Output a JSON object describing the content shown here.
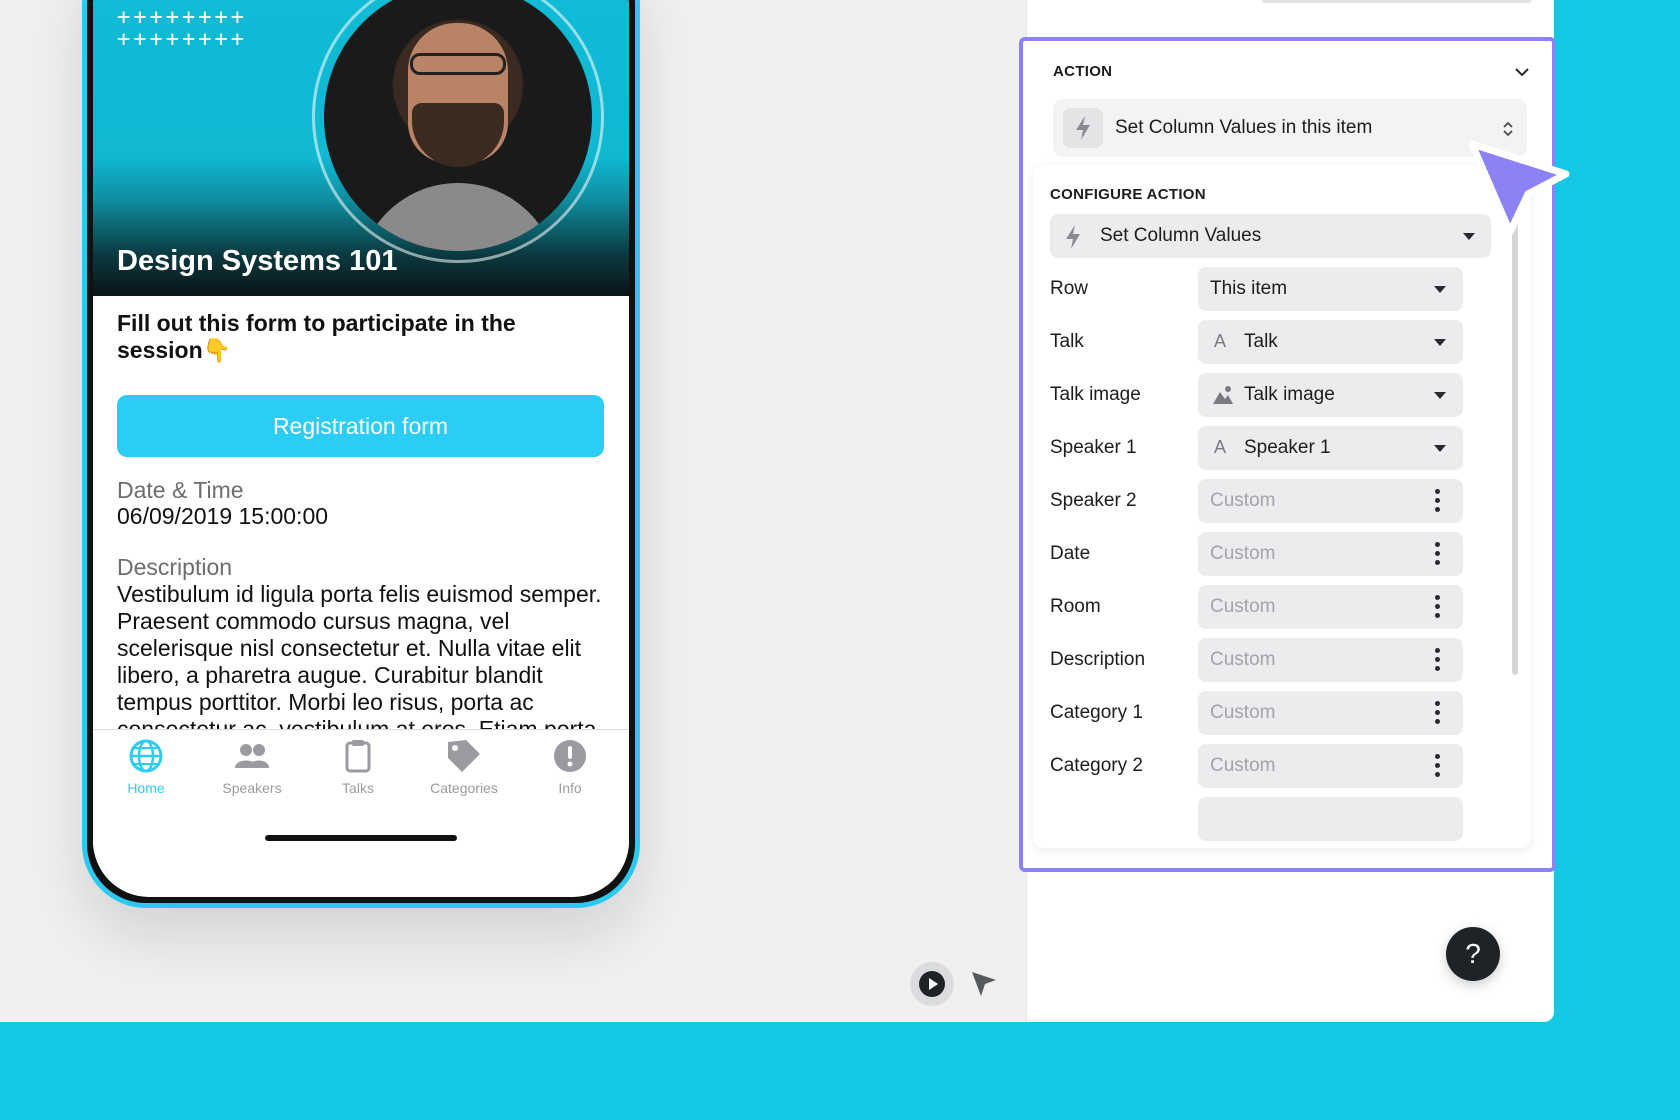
{
  "phone": {
    "hero_title": "Design Systems 101",
    "hero_pattern": "++++++++\n++++++++",
    "intro": "Fill out this form to participate in the session👇",
    "register_button": "Registration form",
    "datetime_label": "Date & Time",
    "datetime_value": "06/09/2019 15:00:00",
    "description_label": "Description",
    "description_text": "Vestibulum id ligula porta felis euismod semper. Praesent commodo cursus magna, vel scelerisque nisl consectetur et. Nulla vitae elit libero, a pharetra augue. Curabitur blandit tempus porttitor. Morbi leo risus, porta ac consectetur ac, vestibulum at eros. Etiam porta sem malesuada magna mollis euismod. Sed",
    "tabs": [
      {
        "label": "Home",
        "icon": "globe-icon",
        "active": true
      },
      {
        "label": "Speakers",
        "icon": "people-icon",
        "active": false
      },
      {
        "label": "Talks",
        "icon": "clipboard-icon",
        "active": false
      },
      {
        "label": "Categories",
        "icon": "tag-icon",
        "active": false
      },
      {
        "label": "Info",
        "icon": "info-icon",
        "active": false
      }
    ]
  },
  "action": {
    "heading": "ACTION",
    "selected": "Set Column Values in this item",
    "configure": {
      "heading": "CONFIGURE ACTION",
      "type": "Set Column Values",
      "rows": [
        {
          "name": "Row",
          "value": "This item",
          "kind": "dropdown",
          "prefix": ""
        },
        {
          "name": "Talk",
          "value": "Talk",
          "kind": "dropdown",
          "prefix": "A"
        },
        {
          "name": "Talk image",
          "value": "Talk image",
          "kind": "dropdown",
          "prefix": "image"
        },
        {
          "name": "Speaker 1",
          "value": "Speaker 1",
          "kind": "dropdown",
          "prefix": "A"
        },
        {
          "name": "Speaker 2",
          "value": "Custom",
          "kind": "custom"
        },
        {
          "name": "Date",
          "value": "Custom",
          "kind": "custom"
        },
        {
          "name": "Room",
          "value": "Custom",
          "kind": "custom"
        },
        {
          "name": "Description",
          "value": "Custom",
          "kind": "custom"
        },
        {
          "name": "Category 1",
          "value": "Custom",
          "kind": "custom"
        },
        {
          "name": "Category 2",
          "value": "Custom",
          "kind": "custom"
        }
      ]
    }
  },
  "help_label": "?",
  "colors": {
    "accent": "#2ccdf5",
    "highlight_border": "#8d82f5",
    "background": "#13c8e3"
  }
}
